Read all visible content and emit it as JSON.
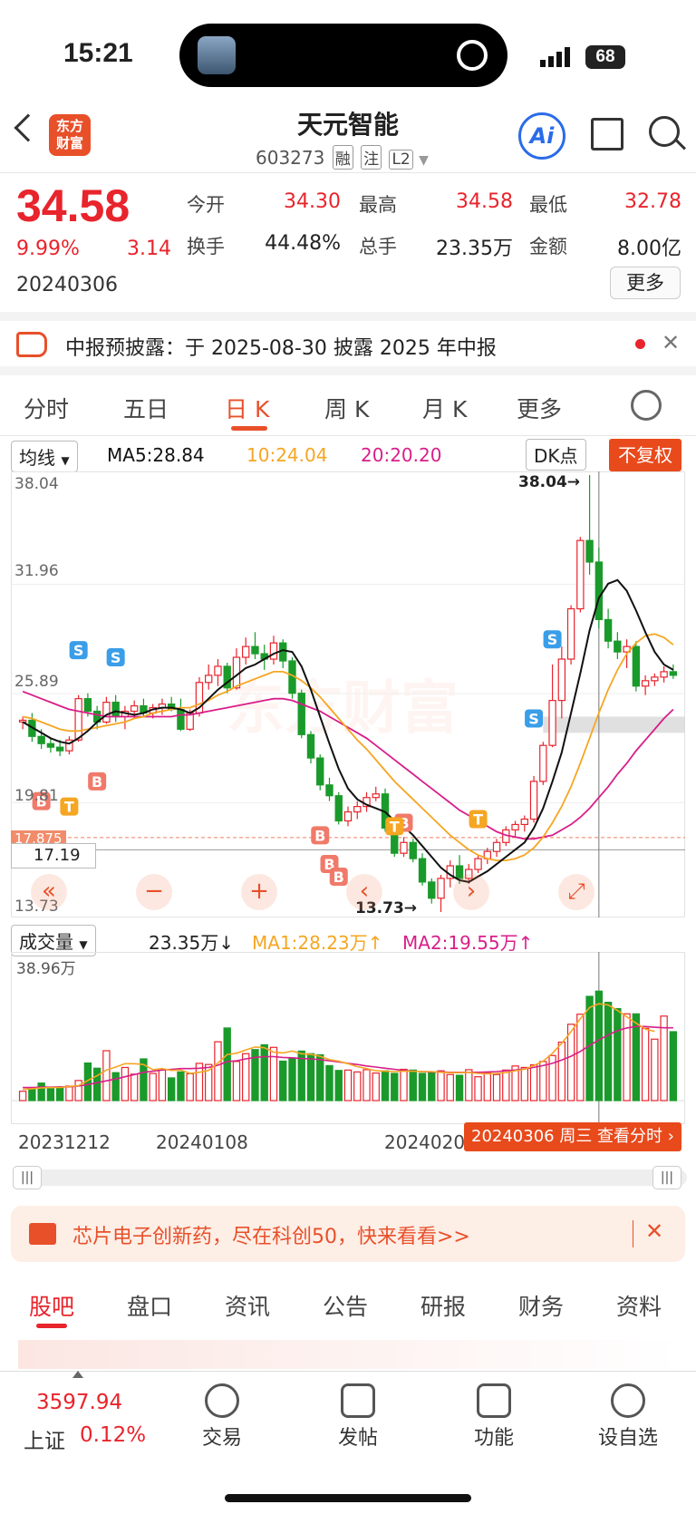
{
  "status_bar": {
    "time": "15:21",
    "battery": "68"
  },
  "header": {
    "app_logo": "东方\n财富",
    "stock_name": "天元智能",
    "stock_code": "603273",
    "tags": [
      "融",
      "注",
      "L2"
    ],
    "ai_label": "Ai"
  },
  "quote": {
    "price": "34.58",
    "change_pct": "9.99%",
    "change": "3.14",
    "date": "20240306",
    "fields": [
      {
        "label": "今开",
        "value": "34.30",
        "color": "#e8242c"
      },
      {
        "label": "最高",
        "value": "34.58",
        "color": "#e8242c"
      },
      {
        "label": "最低",
        "value": "32.78",
        "color": "#e8242c"
      },
      {
        "label": "换手",
        "value": "44.48%",
        "color": "#222222"
      },
      {
        "label": "总手",
        "value": "23.35万",
        "color": "#222222"
      },
      {
        "label": "金额",
        "value": "8.00亿",
        "color": "#222222"
      }
    ],
    "more_label": "更多"
  },
  "notice": {
    "text": "中报预披露：于 2025-08-30 披露 2025 年中报"
  },
  "chart_tabs": [
    "分时",
    "五日",
    "日 K",
    "周 K",
    "月 K",
    "更多"
  ],
  "ma_bar": {
    "selector": "均线",
    "ma5": "MA5:28.84",
    "ma10": "10:24.04",
    "ma20": "20:20.20",
    "dk": "DK点",
    "fq": "不复权"
  },
  "price_axis": {
    "top": "38.04",
    "p2": "31.96",
    "p3": "25.89",
    "p4": "19.81",
    "bottom": "13.73",
    "max_tag": "38.04",
    "min_tag": "13.73",
    "current_line": "17.19",
    "dashed_line": "17.875"
  },
  "markers": {
    "buy": "B",
    "sell": "S",
    "t": "T"
  },
  "nav_buttons": {
    "left": "«",
    "minus": "−",
    "plus": "+",
    "prev": "‹",
    "next": "›",
    "expand": "⤢"
  },
  "volume_bar": {
    "selector": "成交量",
    "vol": "23.35万",
    "ma1": "MA1:28.23万",
    "ma2": "MA2:19.55万",
    "axis_top": "38.96万"
  },
  "xaxis": {
    "d1": "20231212",
    "d2": "20240108",
    "d3": "2024020",
    "tip": "20240306 周三 查看分时"
  },
  "ad": {
    "text": "芯片电子创新药，尽在科创50，快来看看>>"
  },
  "bottom_tabs": [
    "股吧",
    "盘口",
    "资讯",
    "公告",
    "研报",
    "财务",
    "资料"
  ],
  "bottom_bar": {
    "index_value": "3597.94",
    "index_name": "上证",
    "index_pct": "0.12%",
    "items": [
      {
        "label": "交易",
        "icon": "trade-icon"
      },
      {
        "label": "发帖",
        "icon": "post-icon"
      },
      {
        "label": "功能",
        "icon": "function-icon"
      },
      {
        "label": "设自选",
        "icon": "watchlist-icon"
      }
    ]
  },
  "colors": {
    "up": "#e8242c",
    "down": "#1a9a2a",
    "accent": "#e8502a",
    "ma5": "#111111",
    "ma10": "#f5a623",
    "ma20": "#d81e8a"
  },
  "chart_data": {
    "type": "candlestick",
    "ylim": [
      13.73,
      38.04
    ],
    "candles": [
      [
        24.3,
        24.6,
        23.9,
        24.4
      ],
      [
        24.4,
        24.8,
        23.2,
        23.5
      ],
      [
        23.5,
        23.9,
        22.8,
        23.1
      ],
      [
        23.1,
        23.4,
        22.6,
        22.9
      ],
      [
        22.9,
        23.3,
        22.4,
        22.7
      ],
      [
        22.7,
        23.5,
        22.5,
        23.3
      ],
      [
        23.3,
        25.8,
        23.2,
        25.6
      ],
      [
        25.6,
        25.9,
        24.6,
        24.9
      ],
      [
        24.9,
        25.2,
        23.9,
        24.3
      ],
      [
        24.3,
        25.7,
        24.2,
        25.4
      ],
      [
        25.4,
        25.8,
        24.3,
        24.6
      ],
      [
        24.6,
        25.2,
        23.9,
        24.9
      ],
      [
        24.9,
        25.5,
        24.5,
        25.2
      ],
      [
        25.2,
        25.6,
        24.6,
        24.8
      ],
      [
        24.8,
        25.3,
        24.5,
        25.1
      ],
      [
        25.1,
        25.6,
        24.7,
        25.3
      ],
      [
        25.3,
        25.7,
        24.9,
        25.0
      ],
      [
        25.0,
        25.6,
        23.8,
        23.9
      ],
      [
        23.9,
        25.0,
        23.8,
        24.8
      ],
      [
        24.8,
        26.8,
        24.6,
        26.5
      ],
      [
        26.5,
        27.5,
        26.1,
        26.9
      ],
      [
        26.9,
        27.8,
        26.3,
        27.4
      ],
      [
        27.4,
        27.6,
        25.9,
        26.2
      ],
      [
        26.2,
        28.4,
        26.1,
        27.9
      ],
      [
        27.9,
        29.0,
        27.5,
        28.5
      ],
      [
        28.5,
        29.3,
        27.8,
        28.1
      ],
      [
        28.1,
        28.6,
        27.2,
        27.8
      ],
      [
        27.8,
        29.1,
        27.5,
        28.7
      ],
      [
        28.7,
        28.9,
        27.3,
        27.7
      ],
      [
        27.7,
        27.9,
        25.6,
        25.9
      ],
      [
        25.9,
        26.1,
        23.4,
        23.6
      ],
      [
        23.6,
        23.8,
        22.0,
        22.3
      ],
      [
        22.3,
        22.5,
        20.5,
        20.8
      ],
      [
        20.8,
        21.2,
        19.9,
        20.2
      ],
      [
        20.2,
        20.4,
        18.6,
        18.8
      ],
      [
        18.8,
        19.6,
        18.5,
        19.3
      ],
      [
        19.3,
        19.9,
        18.9,
        19.6
      ],
      [
        19.6,
        20.4,
        19.3,
        20.1
      ],
      [
        20.1,
        20.7,
        19.9,
        20.3
      ],
      [
        20.3,
        20.6,
        18.2,
        18.4
      ],
      [
        18.4,
        18.6,
        16.8,
        17.0
      ],
      [
        17.0,
        17.9,
        16.8,
        17.6
      ],
      [
        17.6,
        17.8,
        16.5,
        16.7
      ],
      [
        16.7,
        17.0,
        15.2,
        15.4
      ],
      [
        15.4,
        15.6,
        14.2,
        14.5
      ],
      [
        14.5,
        15.8,
        13.73,
        15.6
      ],
      [
        15.6,
        16.6,
        15.1,
        16.3
      ],
      [
        16.3,
        16.9,
        15.3,
        15.6
      ],
      [
        15.6,
        16.4,
        15.3,
        16.1
      ],
      [
        16.1,
        16.9,
        15.9,
        16.7
      ],
      [
        16.7,
        17.3,
        16.4,
        17.1
      ],
      [
        17.1,
        17.8,
        16.8,
        17.6
      ],
      [
        17.6,
        18.5,
        17.4,
        18.3
      ],
      [
        18.3,
        18.8,
        17.9,
        18.6
      ],
      [
        18.6,
        19.1,
        18.2,
        18.9
      ],
      [
        18.9,
        21.3,
        18.7,
        21.0
      ],
      [
        21.0,
        23.2,
        20.8,
        23.0
      ],
      [
        23.0,
        27.5,
        22.9,
        25.5
      ],
      [
        25.5,
        28.5,
        24.5,
        27.8
      ],
      [
        27.8,
        30.8,
        27.5,
        30.6
      ],
      [
        30.6,
        34.6,
        30.4,
        34.4
      ],
      [
        34.4,
        38.04,
        32.5,
        33.2
      ],
      [
        33.2,
        34.0,
        29.5,
        30.0
      ],
      [
        30.0,
        30.6,
        28.4,
        28.8
      ],
      [
        28.8,
        29.3,
        27.8,
        28.2
      ],
      [
        28.2,
        28.9,
        27.3,
        28.5
      ],
      [
        28.5,
        28.8,
        26.0,
        26.3
      ],
      [
        26.3,
        26.9,
        25.8,
        26.6
      ],
      [
        26.6,
        27.0,
        26.3,
        26.8
      ],
      [
        26.8,
        27.4,
        26.5,
        27.1
      ],
      [
        27.1,
        27.5,
        26.7,
        26.9
      ]
    ],
    "ma5": [
      24.3,
      24.0,
      23.7,
      23.4,
      23.2,
      23.1,
      23.4,
      23.8,
      24.3,
      24.7,
      24.9,
      24.8,
      24.7,
      24.8,
      25.0,
      25.1,
      25.1,
      25.0,
      24.8,
      25.1,
      25.6,
      26.1,
      26.5,
      26.9,
      27.3,
      27.5,
      27.8,
      28.1,
      28.3,
      28.2,
      27.4,
      26.1,
      24.6,
      23.1,
      21.7,
      20.6,
      20.0,
      19.7,
      19.5,
      19.3,
      18.8,
      18.5,
      18.0,
      17.4,
      16.8,
      16.2,
      15.8,
      15.5,
      15.4,
      15.7,
      16.0,
      16.4,
      16.8,
      17.2,
      17.6,
      18.4,
      19.5,
      21.0,
      22.6,
      24.8,
      27.0,
      29.4,
      31.2,
      32.0,
      32.2,
      31.6,
      30.5,
      29.3,
      28.2,
      27.5,
      27.2
    ],
    "ma10": [
      24.6,
      24.5,
      24.3,
      24.1,
      23.9,
      23.8,
      23.8,
      23.9,
      24.0,
      24.1,
      24.2,
      24.3,
      24.5,
      24.6,
      24.8,
      24.9,
      25.0,
      25.1,
      25.1,
      25.3,
      25.5,
      25.8,
      26.0,
      26.3,
      26.5,
      26.7,
      26.9,
      27.1,
      27.1,
      26.9,
      26.6,
      26.2,
      25.7,
      25.1,
      24.5,
      23.9,
      23.3,
      22.8,
      22.2,
      21.6,
      21.0,
      20.5,
      20.0,
      19.5,
      19.0,
      18.5,
      18.0,
      17.6,
      17.2,
      16.9,
      16.7,
      16.6,
      16.6,
      16.7,
      16.9,
      17.3,
      17.9,
      18.7,
      19.6,
      20.7,
      22.0,
      23.4,
      24.8,
      26.1,
      27.2,
      28.1,
      28.7,
      29.1,
      29.2,
      29.0,
      28.6
    ],
    "ma20": [
      26.0,
      25.8,
      25.6,
      25.4,
      25.2,
      25.0,
      24.9,
      24.8,
      24.7,
      24.6,
      24.6,
      24.6,
      24.6,
      24.6,
      24.6,
      24.6,
      24.6,
      24.7,
      24.7,
      24.8,
      24.9,
      25.0,
      25.1,
      25.2,
      25.3,
      25.4,
      25.5,
      25.6,
      25.6,
      25.5,
      25.3,
      25.1,
      24.9,
      24.6,
      24.3,
      24.0,
      23.7,
      23.4,
      23.0,
      22.6,
      22.2,
      21.8,
      21.4,
      21.0,
      20.6,
      20.2,
      19.8,
      19.4,
      19.1,
      18.8,
      18.5,
      18.2,
      18.0,
      17.9,
      17.8,
      17.8,
      17.9,
      18.0,
      18.3,
      18.6,
      19.0,
      19.5,
      20.1,
      20.7,
      21.4,
      22.0,
      22.7,
      23.3,
      23.9,
      24.5,
      25.0
    ],
    "volume": [
      2.5,
      3.4,
      4.7,
      3.2,
      3.5,
      3.9,
      5.4,
      10.1,
      8.7,
      13.4,
      7.5,
      8.9,
      7.1,
      11.2,
      7.3,
      8.2,
      6.1,
      7.7,
      7.2,
      10.0,
      9.7,
      15.8,
      19.5,
      10.5,
      12.6,
      13.7,
      15.0,
      14.3,
      10.6,
      11.4,
      13.3,
      12.6,
      12.3,
      9.4,
      8.1,
      8.2,
      7.7,
      8.3,
      7.4,
      8.0,
      7.3,
      8.4,
      8.2,
      7.3,
      7.7,
      8.0,
      7.0,
      6.8,
      8.3,
      6.4,
      7.5,
      7.0,
      8.2,
      9.3,
      8.9,
      9.6,
      10.5,
      12.1,
      15.7,
      20.5,
      23.2,
      28.0,
      29.4,
      26.4,
      24.7,
      23.3,
      23.3,
      19.4,
      16.5,
      22.7,
      18.5
    ],
    "vol_up": [
      true,
      false,
      false,
      false,
      false,
      true,
      true,
      false,
      false,
      true,
      false,
      true,
      true,
      false,
      true,
      true,
      false,
      false,
      true,
      true,
      true,
      true,
      false,
      true,
      true,
      false,
      false,
      true,
      false,
      false,
      false,
      false,
      false,
      false,
      false,
      true,
      true,
      true,
      true,
      false,
      false,
      true,
      false,
      false,
      false,
      true,
      true,
      false,
      true,
      true,
      true,
      true,
      true,
      true,
      true,
      true,
      true,
      true,
      true,
      true,
      true,
      false,
      false,
      false,
      false,
      true,
      false,
      true,
      true,
      true,
      false
    ],
    "vol_ma1": [
      3.0,
      3.2,
      3.4,
      3.5,
      3.5,
      3.8,
      4.0,
      5.4,
      6.7,
      8.2,
      9.0,
      9.9,
      9.9,
      9.7,
      8.3,
      8.6,
      8.1,
      8.2,
      7.3,
      7.6,
      8.1,
      10.1,
      12.4,
      12.7,
      13.6,
      14.4,
      14.2,
      13.0,
      12.8,
      13.3,
      12.6,
      12.4,
      11.9,
      11.0,
      10.6,
      9.9,
      9.1,
      8.6,
      8.0,
      7.9,
      7.8,
      7.9,
      7.9,
      7.8,
      7.8,
      7.6,
      7.5,
      7.5,
      7.6,
      7.3,
      7.2,
      7.3,
      7.5,
      8.0,
      8.4,
      9.4,
      10.6,
      12.7,
      15.4,
      18.5,
      22.0,
      25.0,
      26.0,
      25.7,
      24.2,
      22.5,
      20.8,
      19.2,
      18.6
    ],
    "vol_ma2": [
      3.5,
      3.5,
      3.6,
      3.6,
      3.7,
      3.7,
      3.9,
      4.3,
      4.8,
      5.3,
      5.8,
      6.4,
      7.0,
      7.6,
      7.9,
      8.2,
      8.4,
      8.6,
      8.6,
      8.7,
      8.9,
      9.5,
      10.5,
      10.7,
      11.2,
      11.6,
      11.8,
      11.8,
      11.6,
      11.5,
      11.3,
      11.2,
      11.0,
      10.7,
      10.4,
      10.0,
      9.7,
      9.3,
      9.0,
      8.7,
      8.4,
      8.1,
      7.9,
      7.8,
      7.7,
      7.7,
      7.6,
      7.6,
      7.6,
      7.6,
      7.7,
      7.8,
      8.0,
      8.2,
      8.5,
      8.9,
      9.4,
      10.0,
      10.9,
      11.9,
      13.2,
      14.8,
      16.3,
      17.6,
      18.8,
      19.5,
      19.9,
      19.9,
      19.7,
      19.55,
      19.55
    ]
  }
}
